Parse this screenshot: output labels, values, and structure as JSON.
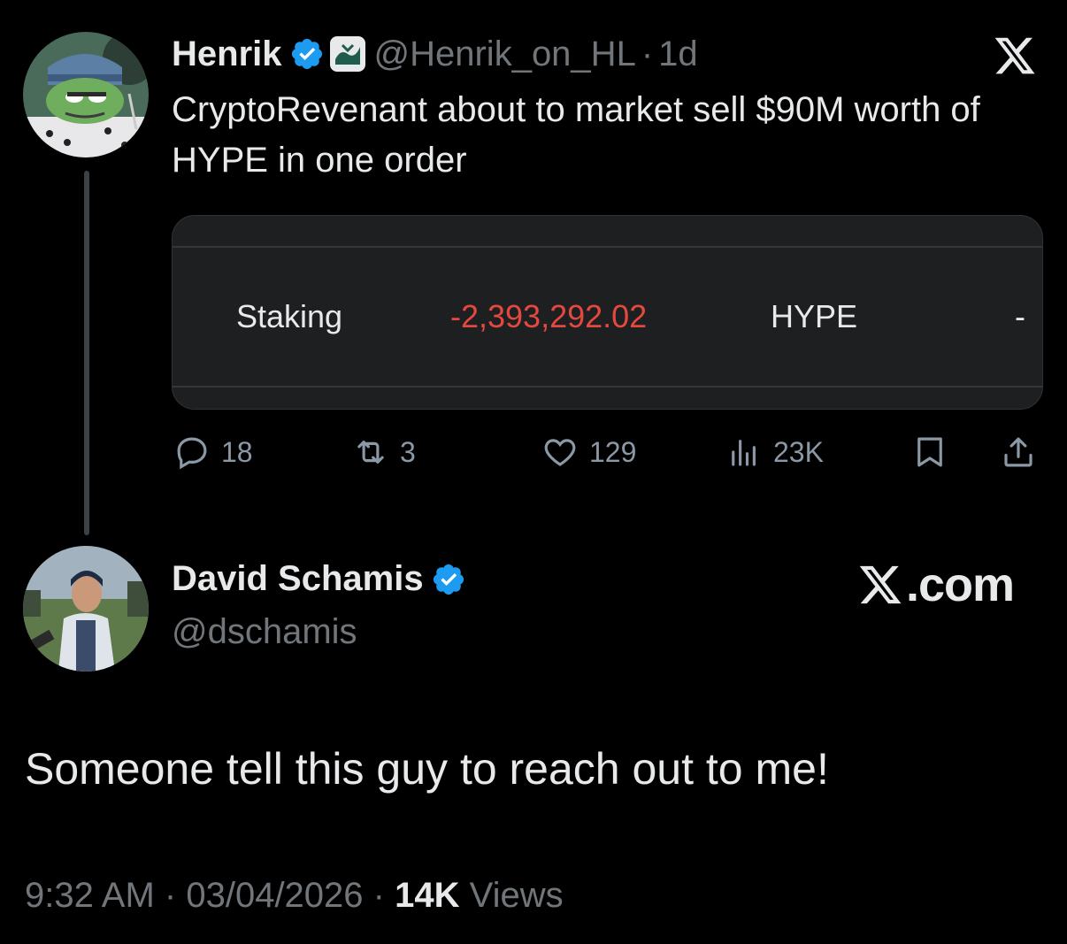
{
  "quoted_tweet": {
    "author_name": "Henrik",
    "author_handle": "@Henrik_on_HL",
    "separator": "·",
    "relative_time": "1d",
    "text": "CryptoRevenant about to market sell $90M worth of HYPE in one order",
    "card": {
      "label": "Staking",
      "amount": "-2,393,292.02",
      "asset": "HYPE",
      "extra": "-"
    },
    "actions": {
      "replies": "18",
      "reposts": "3",
      "likes": "129",
      "views": "23K"
    }
  },
  "tweet": {
    "author_name": "David Schamis",
    "author_handle": "@dschamis",
    "text": "Someone tell this guy to reach out to me!",
    "time": "9:32 AM",
    "separator": "·",
    "date": "03/04/2026",
    "views_count": "14K",
    "views_label": "Views"
  },
  "branding": {
    "x_com_suffix": ".com"
  },
  "icons": {
    "verified": "verified-badge-icon",
    "hyperliquid": "hyperliquid-badge-icon",
    "x_logo": "x-logo-icon",
    "reply": "reply-icon",
    "repost": "repost-icon",
    "like": "heart-icon",
    "views": "views-icon",
    "bookmark": "bookmark-icon",
    "share": "share-icon"
  },
  "colors": {
    "background": "#000000",
    "text": "#e7e9ea",
    "muted": "#71767b",
    "verified": "#1d9bf0",
    "negative": "#e5483f"
  }
}
